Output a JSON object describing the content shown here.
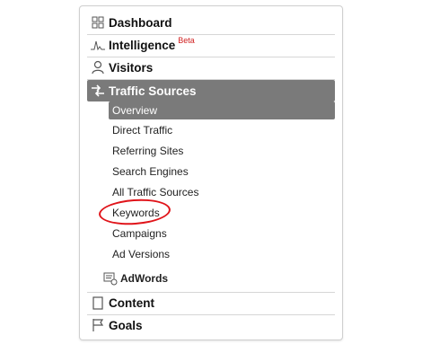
{
  "nav": {
    "dashboard": {
      "label": "Dashboard",
      "icon": "grid-icon"
    },
    "intelligence": {
      "label": "Intelligence",
      "badge": "Beta",
      "icon": "pulse-icon"
    },
    "visitors": {
      "label": "Visitors",
      "icon": "person-icon"
    },
    "traffic_sources": {
      "label": "Traffic Sources",
      "icon": "arrows-icon",
      "items": [
        {
          "label": "Overview",
          "active": true
        },
        {
          "label": "Direct Traffic"
        },
        {
          "label": "Referring Sites"
        },
        {
          "label": "Search Engines"
        },
        {
          "label": "All Traffic Sources"
        },
        {
          "label": "Keywords",
          "highlighted": true
        },
        {
          "label": "Campaigns"
        },
        {
          "label": "Ad Versions"
        }
      ],
      "adwords": {
        "label": "AdWords",
        "icon": "adwords-icon"
      }
    },
    "content": {
      "label": "Content",
      "icon": "page-icon"
    },
    "goals": {
      "label": "Goals",
      "icon": "flag-icon"
    }
  },
  "colors": {
    "active_bg": "#7a7a7a",
    "highlight_circle": "#e0141a",
    "beta": "#d02020"
  }
}
